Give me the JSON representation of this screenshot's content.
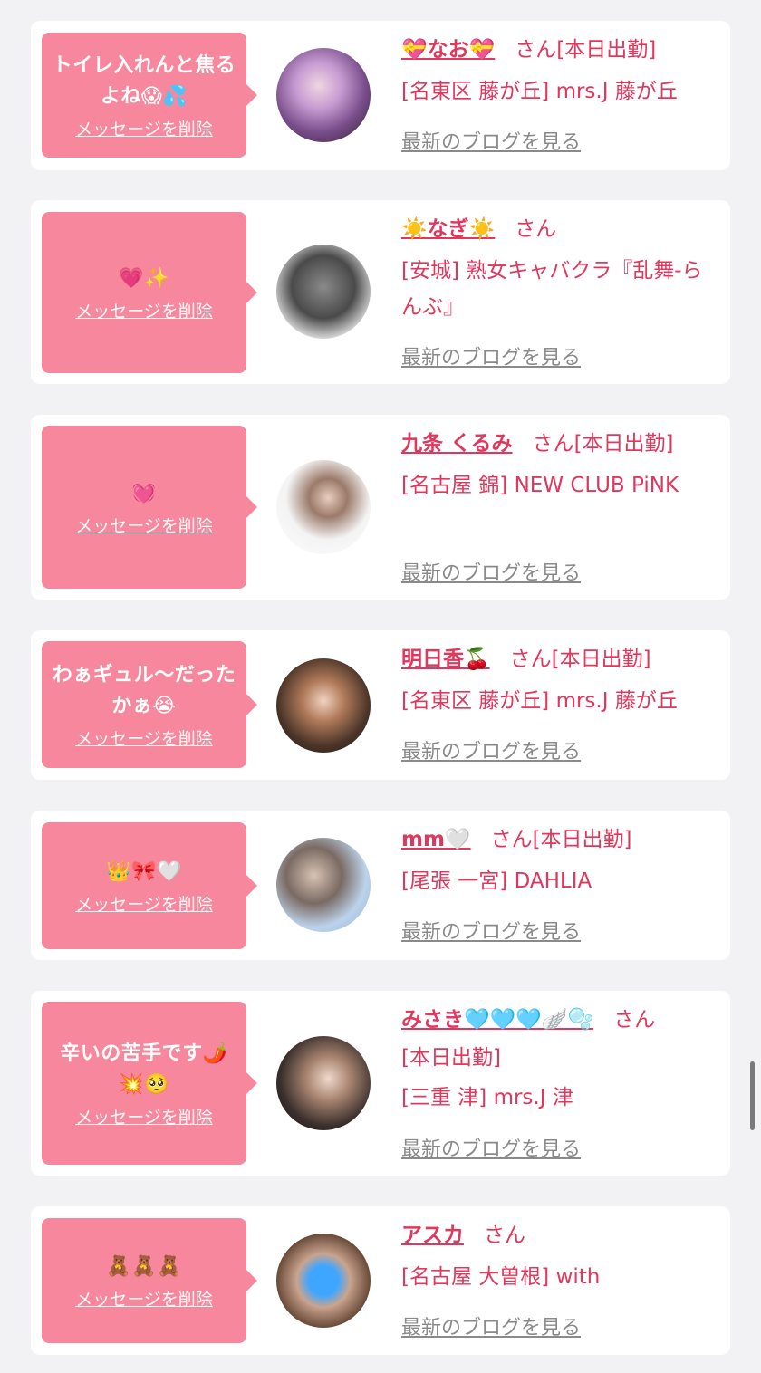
{
  "delete_label": "メッセージを削除",
  "blog_label": "最新のブログを見る",
  "san_label": "さん",
  "colors": {
    "accent": "#e1375d",
    "bubble": "#f7879c",
    "background": "#f2f2f4"
  },
  "messages": [
    {
      "message": "トイレ入れんと焦るよね😱💦",
      "name": "💝なお💝",
      "status": "[本日出勤]",
      "location": "[名東区 藤が丘] mrs.J 藤が丘"
    },
    {
      "message": "💗✨",
      "name": "☀️なぎ☀️",
      "status": "",
      "location": "[安城] 熟女キャバクラ『乱舞-らんぶ』"
    },
    {
      "message": "💓",
      "name": "九条 くるみ",
      "status": "[本日出勤]",
      "location": "[名古屋 錦] NEW CLUB PiNK"
    },
    {
      "message": "わぁギュル〜だったかぁ😭",
      "name": "明日香🍒",
      "status": "[本日出勤]",
      "location": "[名東区 藤が丘] mrs.J 藤が丘"
    },
    {
      "message": "👑🎀🤍",
      "name": "mm🤍",
      "status": "[本日出勤]",
      "location": "[尾張 一宮] DAHLIA"
    },
    {
      "message": "辛いの苦手です🌶️💥🥺",
      "name": "みさき🩵🩵🩵🪽🫧",
      "status": "[本日出勤]",
      "location": "[三重 津] mrs.J 津"
    },
    {
      "message": "🧸🧸🧸",
      "name": "アスカ",
      "status": "",
      "location": "[名古屋 大曽根] with"
    }
  ]
}
